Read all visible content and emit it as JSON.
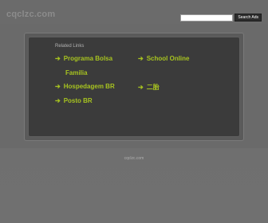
{
  "header": {
    "logo": "cqclzc.com",
    "search": {
      "placeholder": "",
      "value": "",
      "button_label": "Search Ads"
    }
  },
  "panel": {
    "title": "Related Links",
    "left_links": [
      {
        "label": "Programa Bolsa"
      },
      {
        "label": "Familia"
      },
      {
        "label": "Hospedagem BR"
      },
      {
        "label": "Posto BR"
      }
    ],
    "right_links": [
      {
        "label": "School Online"
      },
      {
        "label": "二胎"
      }
    ]
  },
  "footer": {
    "text": "cqclzc.com"
  },
  "colors": {
    "background": "#6e6e6e",
    "panel": "#3b3b3b",
    "link": "#a7c320"
  },
  "icons": {
    "link_arrow": "arrow-right-icon"
  }
}
